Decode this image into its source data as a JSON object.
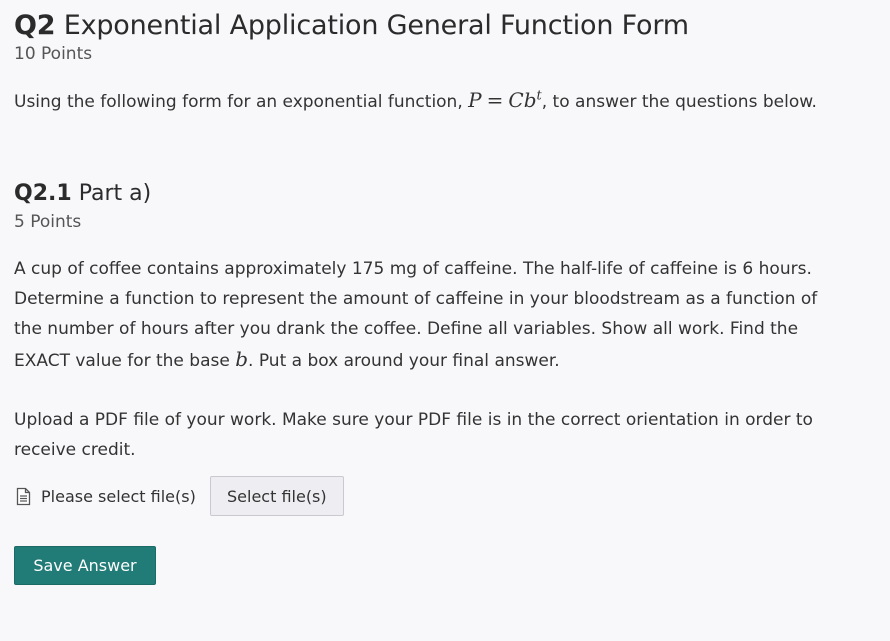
{
  "q2": {
    "number": "Q2",
    "title": "Exponential Application General Function Form",
    "points": "10 Points",
    "intro_before": "Using the following form for an exponential function, ",
    "formula": {
      "lhs": "P",
      "eq": "=",
      "rhs_c": "C",
      "rhs_b": "b",
      "exponent": "t"
    },
    "intro_after": ", to answer the questions below."
  },
  "q21": {
    "number": "Q2.1",
    "title": "Part a)",
    "points": "5 Points",
    "prompt_lines": [
      "A cup of coffee contains approximately 175 mg of caffeine.  The half-life of caffeine is 6 hours.",
      "Determine a function to represent the amount of caffeine in your bloodstream as a function of",
      "the number of hours after you drank the coffee. Define all variables. Show all work. Find the"
    ],
    "prompt_last_before": "EXACT value for the base ",
    "prompt_last_var": "b",
    "prompt_last_after": ". Put a box around your final answer.",
    "upload_lines": [
      "Upload a PDF file of your work. Make sure your PDF file is in the correct orientation in order to",
      "receive credit."
    ],
    "file_status": "Please select file(s)",
    "file_status_icon": "document-icon",
    "select_button": "Select file(s)",
    "save_button": "Save Answer"
  },
  "colors": {
    "background": "#f8f8fb",
    "accent": "#217b76",
    "text": "#333333"
  }
}
